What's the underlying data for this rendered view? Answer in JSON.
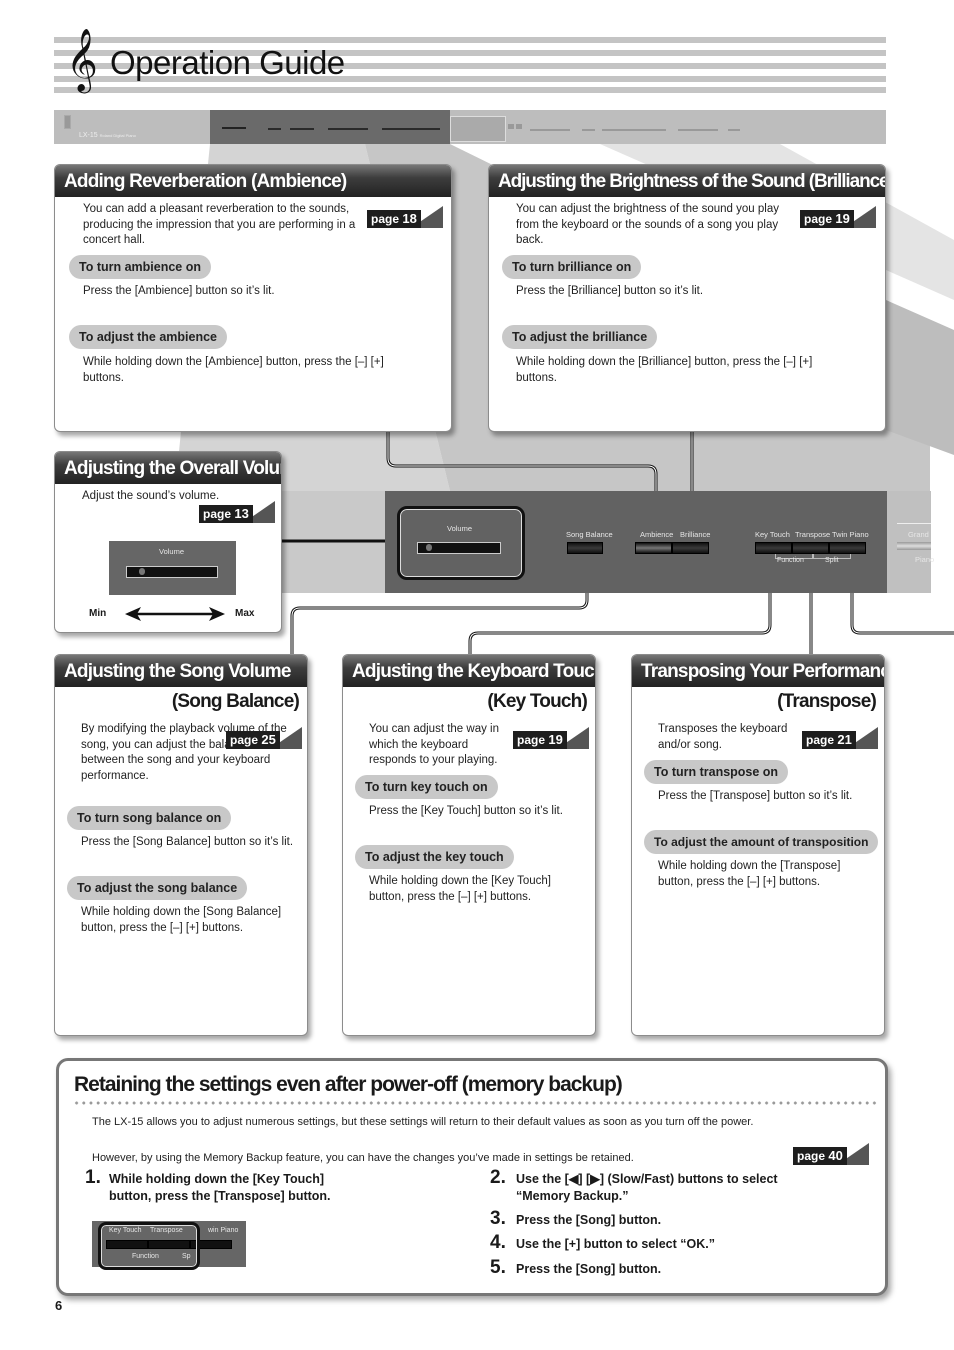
{
  "page": {
    "title": "Operation Guide",
    "page_number": "6",
    "clef_icon": "treble-clef"
  },
  "top_panel": {
    "model": "LX-15",
    "model_sub": "Roland Digital Piano"
  },
  "ambience": {
    "title": "Adding Reverberation (Ambience)",
    "intro": "You can add a pleasant reverberation to the sounds, producing the impression that you are performing in a concert hall.",
    "page_ref_prefix": "page",
    "page_ref_num": "18",
    "pill1": "To turn ambience on",
    "text1": "Press the [Ambience] button so it’s lit.",
    "pill2": "To adjust the ambience",
    "text2": "While holding down the [Ambience] button, press the [–] [+] buttons."
  },
  "brilliance": {
    "title": "Adjusting the Brightness of the Sound (Brilliance)",
    "intro": "You can adjust the brightness of the sound you play from the keyboard or the sounds of a song you play back.",
    "page_ref_prefix": "page",
    "page_ref_num": "19",
    "pill1": "To turn brilliance on",
    "text1": "Press the [Brilliance] button so it’s lit.",
    "pill2": "To adjust the brilliance",
    "text2": "While holding down the [Brilliance] button, press the [–] [+] buttons."
  },
  "volume": {
    "title": "Adjusting the Overall Volume",
    "intro": "Adjust the sound’s volume.",
    "page_ref_prefix": "page",
    "page_ref_num": "13",
    "slider_label": "Volume",
    "min_label": "Min",
    "max_label": "Max"
  },
  "panel": {
    "volume_label": "Volume",
    "song_balance": "Song Balance",
    "ambience": "Ambience",
    "brilliance": "Brilliance",
    "key_touch": "Key Touch",
    "transpose": "Transpose",
    "twin_piano": "Twin Piano",
    "function": "Function",
    "split": "Split",
    "grand": "Grand",
    "piano": "Piano"
  },
  "song_balance": {
    "title": "Adjusting the Song Volume",
    "subtitle": "(Song Balance)",
    "intro": "By modifying the playback volume of the song, you can adjust the balance between the song and your keyboard performance.",
    "page_ref_prefix": "page",
    "page_ref_num": "25",
    "pill1": "To turn song balance on",
    "text1": "Press the [Song Balance] button so it’s lit.",
    "pill2": "To adjust the song balance",
    "text2": "While holding down the [Song Balance] button, press the [–] [+] buttons."
  },
  "key_touch": {
    "title": "Adjusting the Keyboard Touch",
    "subtitle": "(Key Touch)",
    "intro": "You can adjust the way in which the keyboard responds to your playing.",
    "page_ref_prefix": "page",
    "page_ref_num": "19",
    "pill1": "To turn key touch on",
    "text1": "Press the [Key Touch] button so it’s lit.",
    "pill2": "To adjust the key touch",
    "text2": "While holding down the [Key Touch] button, press the [–] [+] buttons."
  },
  "transpose": {
    "title": "Transposing Your Performance",
    "subtitle": "(Transpose)",
    "intro": "Transposes the keyboard and/or song.",
    "page_ref_prefix": "page",
    "page_ref_num": "21",
    "pill1": "To turn transpose on",
    "text1": "Press the [Transpose] button so it’s lit.",
    "pill2": "To adjust the amount of transposition",
    "text2": "While holding down the [Transpose] button, press the [–] [+] buttons."
  },
  "memory": {
    "title": "Retaining the settings even after power-off (memory backup)",
    "para1": "The LX-15 allows you to adjust numerous settings, but these settings will return to their default values as soon as you turn off the power.",
    "para2": "However, by using the Memory Backup feature, you can have the changes you’ve made in settings be retained.",
    "page_ref_prefix": "page",
    "page_ref_num": "40",
    "steps": [
      {
        "num": "1.",
        "text": "While holding down the [Key Touch] button, press the [Transpose] button."
      },
      {
        "num": "2.",
        "text": "Use the [◀] [▶] (Slow/Fast) buttons to select “Memory Backup.”"
      },
      {
        "num": "3.",
        "text": "Press the [Song] button."
      },
      {
        "num": "4.",
        "text": "Use the [+] button to select “OK.”"
      },
      {
        "num": "5.",
        "text": "Press the [Song] button."
      }
    ],
    "inset": {
      "key_touch": "Key Touch",
      "transpose": "Transpose",
      "twin_piano": "win Piano",
      "function": "Function",
      "split": "Sp"
    }
  }
}
